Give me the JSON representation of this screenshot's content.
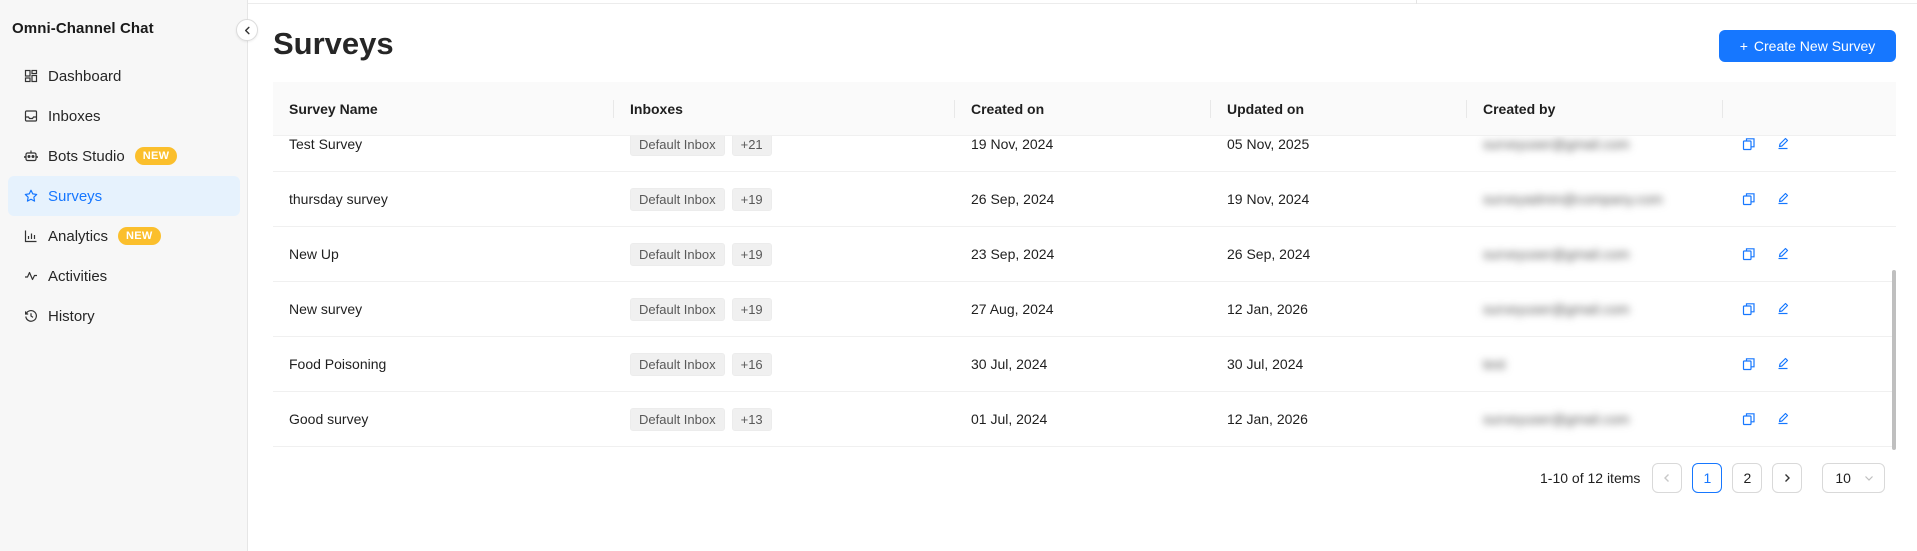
{
  "app": {
    "title": "Omni-Channel Chat"
  },
  "sidebar": {
    "items": [
      {
        "label": "Dashboard",
        "icon": "dashboard-icon",
        "active": false
      },
      {
        "label": "Inboxes",
        "icon": "inbox-icon",
        "active": false
      },
      {
        "label": "Bots Studio",
        "icon": "bot-icon",
        "active": false,
        "badge": "NEW"
      },
      {
        "label": "Surveys",
        "icon": "star-icon",
        "active": true
      },
      {
        "label": "Analytics",
        "icon": "bar-chart-icon",
        "active": false,
        "badge": "NEW"
      },
      {
        "label": "Activities",
        "icon": "activity-icon",
        "active": false
      },
      {
        "label": "History",
        "icon": "history-icon",
        "active": false
      }
    ]
  },
  "page": {
    "title": "Surveys",
    "create_button": "Create New Survey",
    "create_icon": "+"
  },
  "table": {
    "columns": [
      "Survey Name",
      "Inboxes",
      "Created on",
      "Updated on",
      "Created by",
      ""
    ],
    "rows": [
      {
        "name": "Test Survey",
        "inbox": "Default Inbox",
        "extra": "+21",
        "created": "19 Nov, 2024",
        "updated": "05 Nov, 2025",
        "created_by": "surveyuser@gmail.com"
      },
      {
        "name": "thursday survey",
        "inbox": "Default Inbox",
        "extra": "+19",
        "created": "26 Sep, 2024",
        "updated": "19 Nov, 2024",
        "created_by": "surveyadmin@company.com"
      },
      {
        "name": "New Up",
        "inbox": "Default Inbox",
        "extra": "+19",
        "created": "23 Sep, 2024",
        "updated": "26 Sep, 2024",
        "created_by": "surveyuser@gmail.com"
      },
      {
        "name": "New survey",
        "inbox": "Default Inbox",
        "extra": "+19",
        "created": "27 Aug, 2024",
        "updated": "12 Jan, 2026",
        "created_by": "surveyuser@gmail.com"
      },
      {
        "name": "Food Poisoning",
        "inbox": "Default Inbox",
        "extra": "+16",
        "created": "30 Jul, 2024",
        "updated": "30 Jul, 2024",
        "created_by": "test"
      },
      {
        "name": "Good survey",
        "inbox": "Default Inbox",
        "extra": "+13",
        "created": "01 Jul, 2024",
        "updated": "12 Jan, 2026",
        "created_by": "surveyuser@gmail.com"
      }
    ]
  },
  "pagination": {
    "total_text": "1-10 of 12 items",
    "pages": [
      "1",
      "2"
    ],
    "current": "1",
    "page_size": "10"
  },
  "colors": {
    "accent": "#1677ff",
    "badge": "#fbbf2c",
    "sidebar_bg": "#f7f7f7",
    "active_bg": "#e6f2fd"
  }
}
